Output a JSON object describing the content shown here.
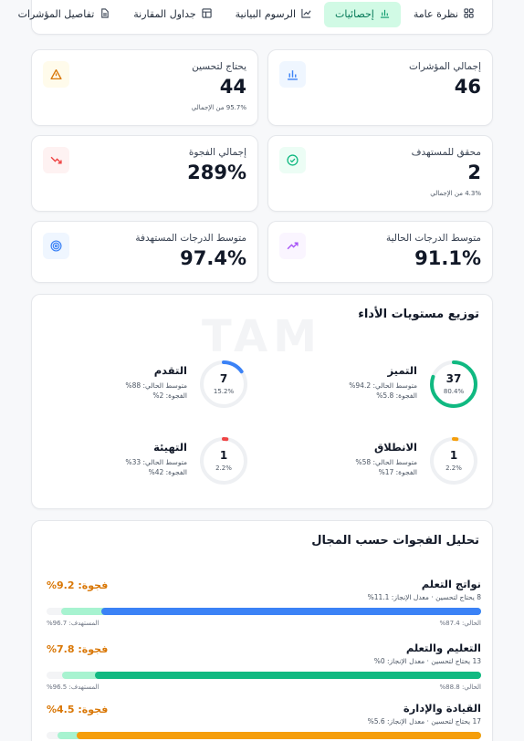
{
  "tabs": [
    {
      "label": "نظرة عامة",
      "icon": "grid-icon",
      "active": false
    },
    {
      "label": "إحصائيات",
      "icon": "bar-chart-icon",
      "active": true
    },
    {
      "label": "الرسوم البيانية",
      "icon": "line-chart-icon",
      "active": false
    },
    {
      "label": "جداول المقارنة",
      "icon": "table-icon",
      "active": false
    },
    {
      "label": "تفاصيل المؤشرات",
      "icon": "document-icon",
      "active": false
    }
  ],
  "stats": {
    "total_indicators": {
      "label": "إجمالي المؤشرات",
      "value": "46",
      "icon": "bar-chart-icon",
      "color": "#3b82f6"
    },
    "needs_improvement": {
      "label": "يحتاج لتحسين",
      "value": "44",
      "sub": "95.7% من الإجمالي",
      "icon": "warning-icon",
      "color": "#f59e0b"
    },
    "achieved_target": {
      "label": "محقق للمستهدف",
      "value": "2",
      "sub": "4.3% من الإجمالي",
      "icon": "check-circle-icon",
      "color": "#10b981"
    },
    "total_gap": {
      "label": "إجمالي الفجوة",
      "value": "289%",
      "icon": "trending-down-icon",
      "color": "#ef4444"
    },
    "avg_current": {
      "label": "متوسط الدرجات الحالية",
      "value": "91.1%",
      "icon": "trending-up-icon",
      "color": "#a855f7"
    },
    "avg_target": {
      "label": "متوسط الدرجات المستهدفة",
      "value": "97.4%",
      "icon": "target-icon",
      "color": "#3b82f6"
    }
  },
  "performance": {
    "title": "توزيع مستويات الأداء",
    "watermark": "TAM",
    "levels": [
      {
        "name": "التميز",
        "count": "37",
        "pct": "80.4%",
        "fraction": 0.804,
        "current": "متوسط الحالي: 94.2%",
        "gap": "الفجوة: 5.8%",
        "color": "#10b981"
      },
      {
        "name": "التقدم",
        "count": "7",
        "pct": "15.2%",
        "fraction": 0.152,
        "current": "متوسط الحالي: 88%",
        "gap": "الفجوة: 2%",
        "color": "#3b82f6"
      },
      {
        "name": "الانطلاق",
        "count": "1",
        "pct": "2.2%",
        "fraction": 0.022,
        "current": "متوسط الحالي: 58%",
        "gap": "الفجوة: 17%",
        "color": "#f59e0b"
      },
      {
        "name": "التهيئة",
        "count": "1",
        "pct": "2.2%",
        "fraction": 0.022,
        "current": "متوسط الحالي: 33%",
        "gap": "الفجوة: 42%",
        "color": "#ef4444"
      }
    ]
  },
  "gaps": {
    "title": "تحليل الفجوات حسب المجال",
    "domains": [
      {
        "name": "نواتج التعلم",
        "sub": "8 يحتاج لتحسين · معدل الإنجاز: 11.1%",
        "gap": "فجوة: 9.2%",
        "current_label": "الحالي: 87.4%",
        "target_label": "المستهدف: 96.7%",
        "current": 0.874,
        "target": 0.967,
        "color": "#3b82f6"
      },
      {
        "name": "التعليم والتعلم",
        "sub": "13 يحتاج لتحسين · معدل الإنجاز: 0%",
        "gap": "فجوة: 7.8%",
        "current_label": "الحالي: 88.8%",
        "target_label": "المستهدف: 96.5%",
        "current": 0.888,
        "target": 0.965,
        "color": "#10b981"
      },
      {
        "name": "القيادة والإدارة",
        "sub": "17 يحتاج لتحسين · معدل الإنجاز: 5.6%",
        "gap": "فجوة: 4.5%",
        "current_label": "",
        "target_label": "",
        "current": 0.93,
        "target": 0.975,
        "color": "#f59e0b"
      }
    ]
  }
}
